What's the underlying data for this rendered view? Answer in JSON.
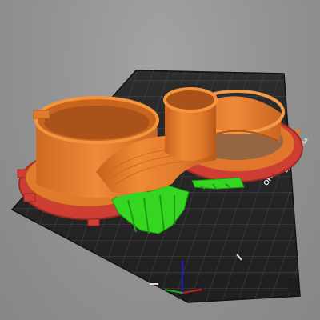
{
  "viewport": {
    "bed_logo": {
      "line1": "ORIGINAL",
      "line2": "PRUSA",
      "line3": "by Josef Prusa"
    },
    "colors": {
      "background": "#949494",
      "bed": "#2a2a2a",
      "bed_grid": "#4a4a4a",
      "model_orange": "#e07a2c",
      "model_orange_dark": "#b85d1a",
      "brim_red": "#d8433a",
      "support_green": "#2fd61f",
      "axis_x": "#d11a1a",
      "axis_y": "#19b219",
      "axis_z": "#1a1ad1"
    },
    "axes": [
      "x-axis",
      "y-axis",
      "z-axis"
    ]
  }
}
